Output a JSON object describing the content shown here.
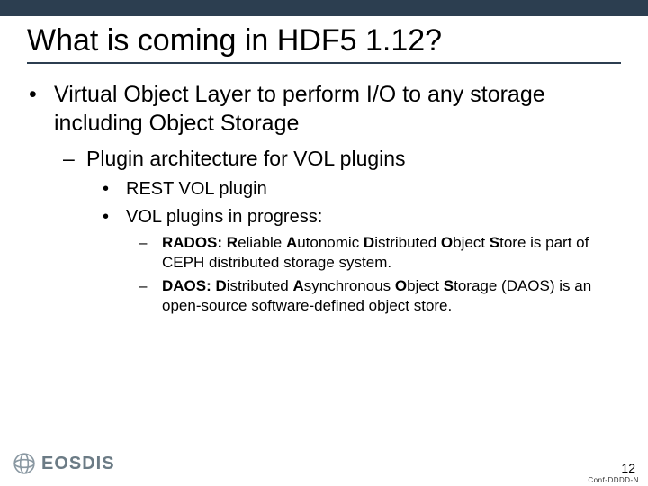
{
  "title": "What is coming in HDF5 1.12?",
  "bullets": {
    "l1": "Virtual Object Layer to perform I/O to any storage including Object Storage",
    "l2": "Plugin architecture for VOL plugins",
    "l3a": "REST VOL plugin",
    "l3b": "VOL plugins in progress:",
    "l4a": {
      "bold": "RADOS: R",
      "mid1": "eliable ",
      "b2": "A",
      "mid2": "utonomic ",
      "b3": "D",
      "mid3": "istributed ",
      "b4": "O",
      "mid4": "bject ",
      "b5": "S",
      "rest": "tore is part of CEPH distributed storage system."
    },
    "l4b": {
      "bold": "DAOS: D",
      "mid1": "istributed ",
      "b2": "A",
      "mid2": "synchronous ",
      "b3": "O",
      "mid3": "bject ",
      "b4": "S",
      "rest": "torage (DAOS) is an open-source software-defined object store."
    }
  },
  "footer": {
    "logo_text": "EOSDIS",
    "page_number": "12",
    "confidential": "Conf-DDDD-N"
  }
}
